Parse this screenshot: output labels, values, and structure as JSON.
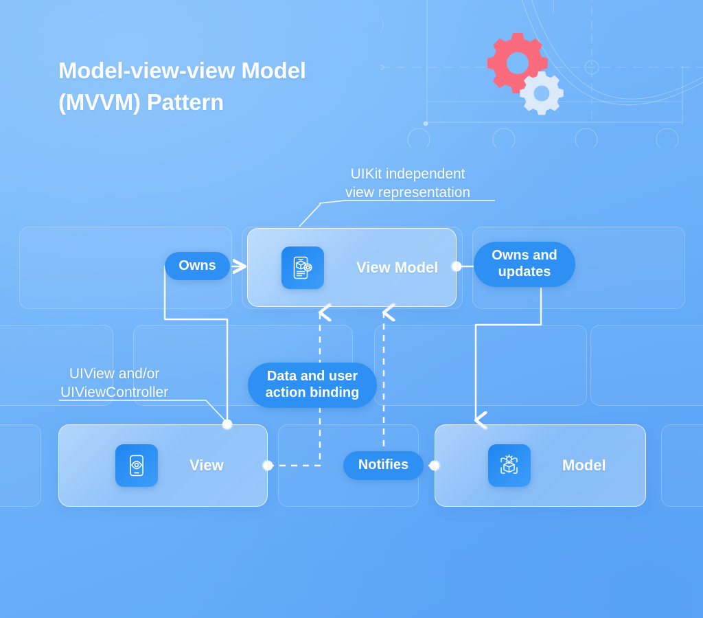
{
  "title": "Model-view-view Model\n(MVVM) Pattern",
  "theme": {
    "background_blue": "#6fb2f9",
    "accent_blue": "#2d90f2",
    "tile_blue": "#1f84ef",
    "gear_red": "#fa6b7e",
    "gear_white": "#dce9f8",
    "text_white": "#ffffff"
  },
  "nodes": [
    {
      "id": "viewmodel",
      "label": "View Model",
      "icon": "phone-cube-gear-icon"
    },
    {
      "id": "view",
      "label": "View",
      "icon": "phone-eye-icon"
    },
    {
      "id": "model",
      "label": "Model",
      "icon": "cube-gear-brackets-icon"
    }
  ],
  "pills": [
    {
      "id": "owns",
      "label": "Owns"
    },
    {
      "id": "owns_updates",
      "label": "Owns and\nupdates"
    },
    {
      "id": "binding",
      "label": "Data and user\naction binding"
    },
    {
      "id": "notifies",
      "label": "Notifies"
    }
  ],
  "annotations": [
    {
      "id": "uikit",
      "text": "UIKit independent\nview representation",
      "target": "viewmodel"
    },
    {
      "id": "uiview",
      "text": "UIView and/or\nUIViewController",
      "target": "view"
    }
  ],
  "decor": {
    "gear_large": "gear-icon",
    "gear_small": "gear-icon"
  },
  "relations": [
    {
      "from": "view",
      "to": "viewmodel",
      "label": "Owns",
      "style": "solid"
    },
    {
      "from": "viewmodel",
      "to": "model",
      "label": "Owns and updates",
      "style": "solid"
    },
    {
      "from": "view",
      "to": "viewmodel",
      "label": "Data and user action binding",
      "style": "dashed"
    },
    {
      "from": "model",
      "to": "viewmodel",
      "label": "Notifies",
      "style": "dashed"
    }
  ]
}
